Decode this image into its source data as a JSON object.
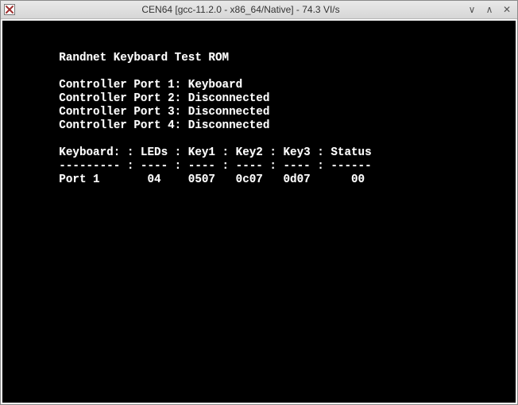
{
  "window": {
    "title": "CEN64 [gcc-11.2.0 - x86_64/Native] - 74.3 VI/s",
    "icon": "app-x-icon",
    "controls": {
      "minimize": "∨",
      "maximize": "∧",
      "close": "✕"
    }
  },
  "rom": {
    "title": "Randnet Keyboard Test ROM",
    "ports": [
      {
        "label": "Controller Port 1",
        "status": "Keyboard"
      },
      {
        "label": "Controller Port 2",
        "status": "Disconnected"
      },
      {
        "label": "Controller Port 3",
        "status": "Disconnected"
      },
      {
        "label": "Controller Port 4",
        "status": "Disconnected"
      }
    ],
    "table": {
      "headers": [
        "Keyboard:",
        "LEDs",
        "Key1",
        "Key2",
        "Key3",
        "Status"
      ],
      "underline": [
        "---------",
        "----",
        "----",
        "----",
        "----",
        "------"
      ],
      "sep": ":",
      "rows": [
        {
          "name": "Port 1",
          "leds": "04",
          "key1": "0507",
          "key2": "0c07",
          "key3": "0d07",
          "status": "00"
        }
      ]
    }
  }
}
